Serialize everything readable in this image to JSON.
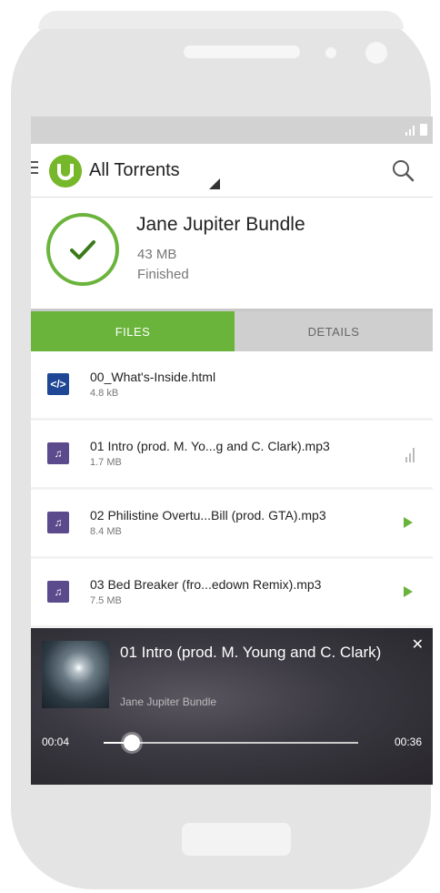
{
  "app": {
    "title": "All Torrents"
  },
  "torrent": {
    "name": "Jane Jupiter Bundle",
    "size": "43 MB",
    "status": "Finished"
  },
  "tabs": [
    {
      "label": "FILES",
      "active": true
    },
    {
      "label": "DETAILS",
      "active": false
    }
  ],
  "files": [
    {
      "name": "00_What's-Inside.html",
      "size": "4.8 kB",
      "icon": "code-file-icon"
    },
    {
      "name": "01 Intro (prod. M. Yo...g and C. Clark).mp3",
      "size": "1.7 MB",
      "icon": "music-note-icon"
    },
    {
      "name": "02 Philistine Overtu...Bill (prod. GTA).mp3",
      "size": "8.4 MB",
      "icon": "music-note-icon"
    },
    {
      "name": "03 Bed Breaker (fro...edown Remix).mp3",
      "size": "7.5 MB",
      "icon": "music-note-icon"
    }
  ],
  "player": {
    "title": "01 Intro (prod. M. Young and C. Clark)",
    "album": "Jane Jupiter Bundle",
    "elapsed": "00:04",
    "duration": "00:36",
    "progress": 0.11
  },
  "colors": {
    "accent_green": "#6ab43c",
    "logo_green": "#76b82a",
    "html_icon_bg": "#1f4796",
    "audio_icon_bg": "#5b4a8c"
  }
}
